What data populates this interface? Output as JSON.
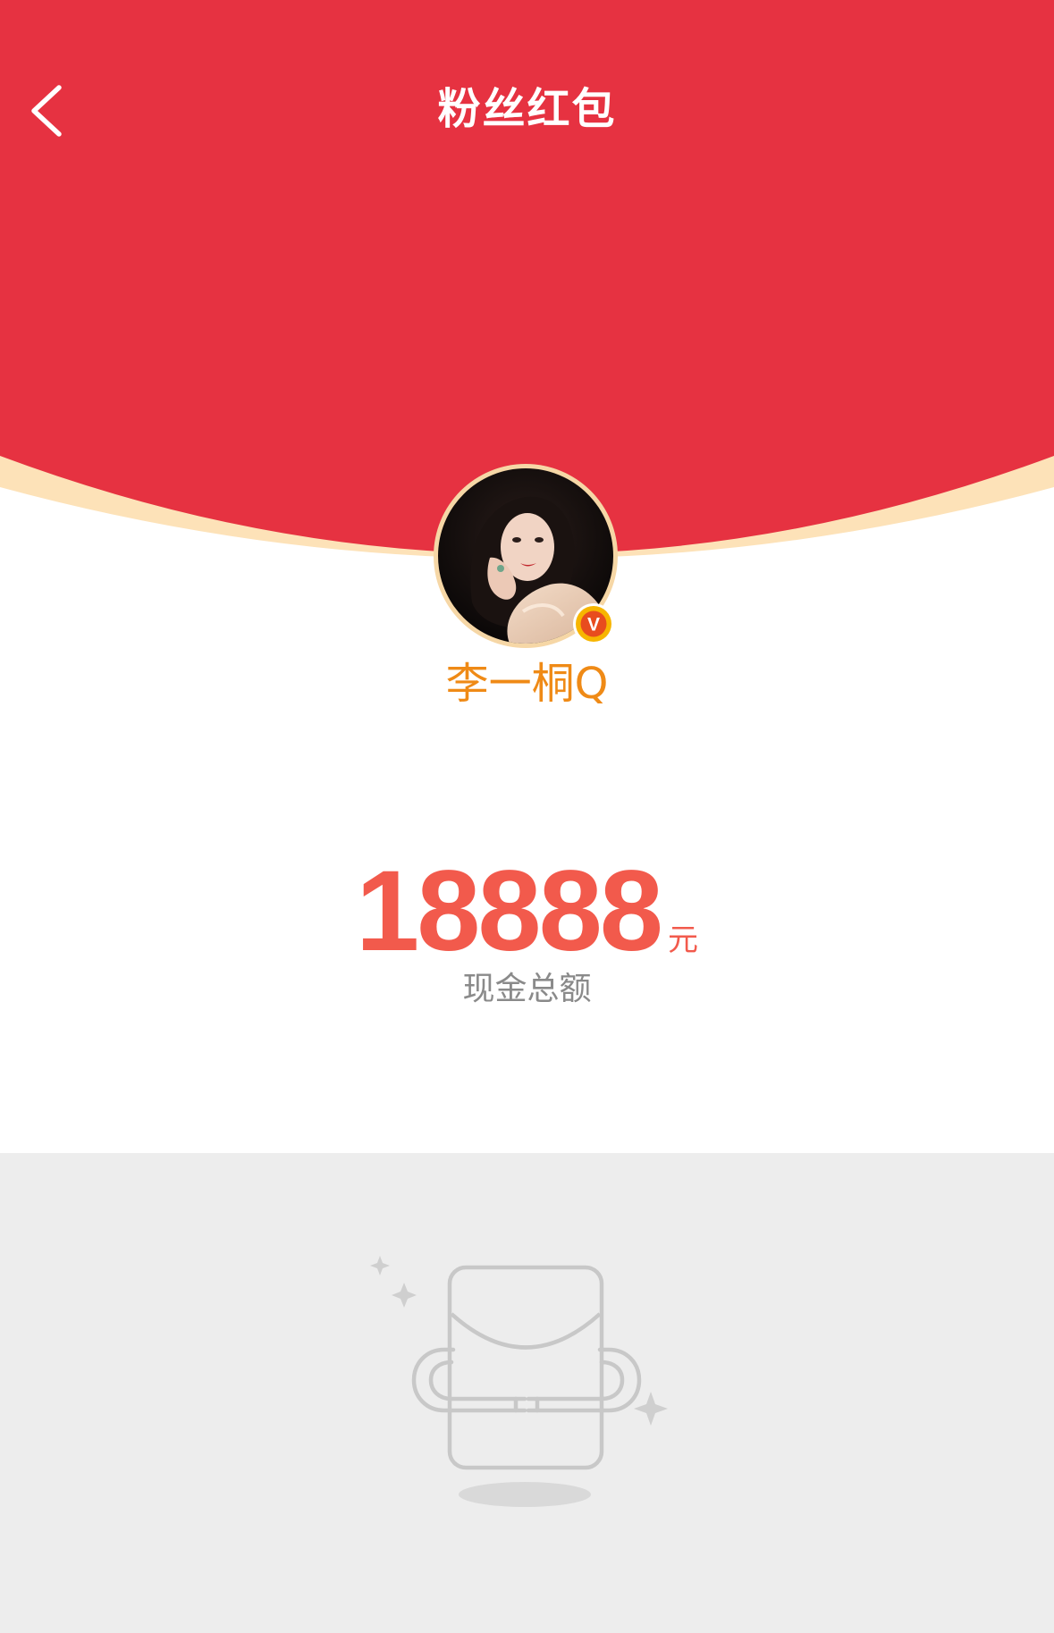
{
  "header": {
    "title": "粉丝红包",
    "back_icon": "chevron-left-icon"
  },
  "profile": {
    "username": "李一桐Q",
    "verified_icon": "verified-v-icon",
    "verified_letter": "V"
  },
  "amount": {
    "value": "18888",
    "unit": "元",
    "caption": "现金总额"
  },
  "empty_state": {
    "icon": "empty-red-envelope-icon"
  },
  "colors": {
    "primary_red": "#e63241",
    "cream": "#fde2b8",
    "amount_red": "#f25a4c",
    "username_orange": "#ef8a16",
    "empty_bg": "#ededed"
  }
}
